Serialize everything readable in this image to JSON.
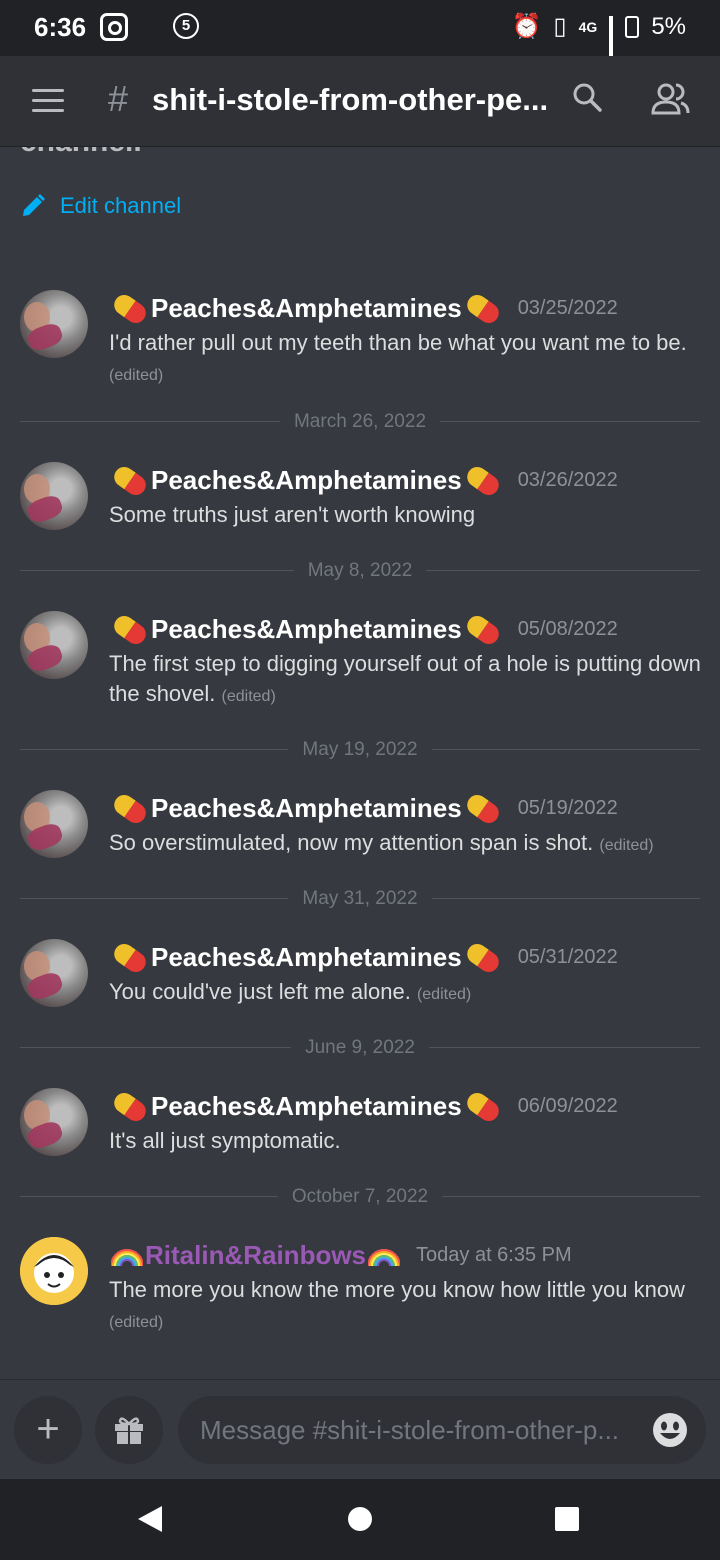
{
  "status_bar": {
    "time": "6:36",
    "notification_count": "5",
    "network": "4G",
    "battery": "5%"
  },
  "header": {
    "channel_title": "shit-i-stole-from-other-pe...",
    "hash": "#"
  },
  "intro": {
    "cut_text": "channel.",
    "edit_channel_label": "Edit channel"
  },
  "messages": [
    {
      "author": "Peaches&Amphetamines",
      "timestamp": "03/25/2022",
      "text": "I'd rather pull out my teeth than be what you want me to be.",
      "edited": "(edited)"
    },
    {
      "divider": "March 26, 2022"
    },
    {
      "author": "Peaches&Amphetamines",
      "timestamp": "03/26/2022",
      "text": "Some truths just aren't worth knowing",
      "edited": ""
    },
    {
      "divider": "May 8, 2022"
    },
    {
      "author": "Peaches&Amphetamines",
      "timestamp": "05/08/2022",
      "text": "The first step to digging yourself out of a hole is putting down the shovel.",
      "edited": "(edited)"
    },
    {
      "divider": "May 19, 2022"
    },
    {
      "author": "Peaches&Amphetamines",
      "timestamp": "05/19/2022",
      "text": "So overstimulated, now my attention span is shot.",
      "edited": "(edited)"
    },
    {
      "divider": "May 31, 2022"
    },
    {
      "author": "Peaches&Amphetamines",
      "timestamp": "05/31/2022",
      "text": "You could've just left me alone.",
      "edited": "(edited)"
    },
    {
      "divider": "June 9, 2022"
    },
    {
      "author": "Peaches&Amphetamines",
      "timestamp": "06/09/2022",
      "text": "It's all just symptomatic.",
      "edited": ""
    },
    {
      "divider": "October 7, 2022"
    },
    {
      "author": "Ritalin&Rainbows",
      "timestamp": "Today at 6:35 PM",
      "text": "The more you know the more you know how little you know",
      "edited": "(edited)"
    }
  ],
  "composer": {
    "placeholder": "Message #shit-i-stole-from-other-p..."
  },
  "colors": {
    "background": "#36393f",
    "link": "#00aff4",
    "username_purple": "#9b59b6"
  }
}
